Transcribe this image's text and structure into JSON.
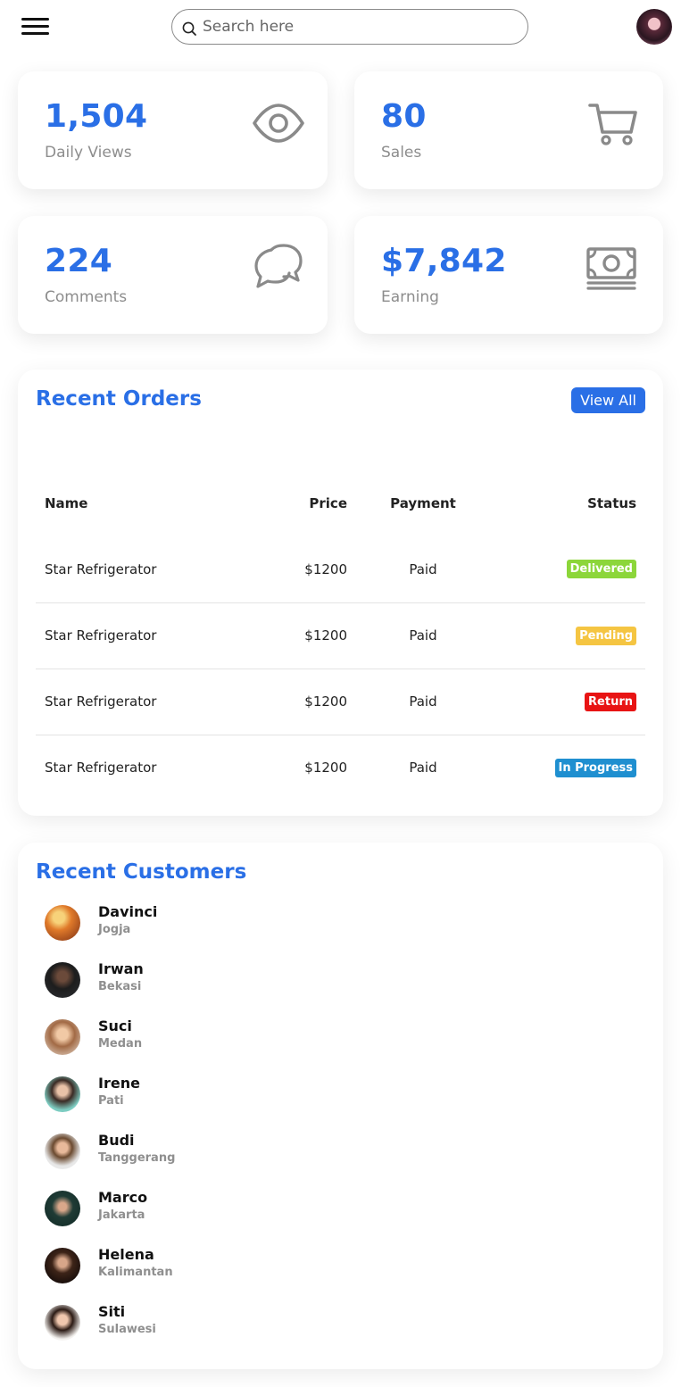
{
  "header": {
    "search_placeholder": "Search here",
    "icons": {
      "menu": "hamburger-menu-icon",
      "search": "search-icon"
    }
  },
  "stats": [
    {
      "value": "1,504",
      "label": "Daily Views",
      "icon": "eye-icon"
    },
    {
      "value": "80",
      "label": "Sales",
      "icon": "cart-icon"
    },
    {
      "value": "224",
      "label": "Comments",
      "icon": "chat-bubbles-icon"
    },
    {
      "value": "$7,842",
      "label": "Earning",
      "icon": "cash-icon"
    }
  ],
  "orders": {
    "title": "Recent Orders",
    "view_all_label": "View All",
    "columns": {
      "name": "Name",
      "price": "Price",
      "payment": "Payment",
      "status": "Status"
    },
    "rows": [
      {
        "name": "Star Refrigerator",
        "price": "$1200",
        "payment": "Paid",
        "status": "Delivered",
        "status_color": "#8cd63a"
      },
      {
        "name": "Star Refrigerator",
        "price": "$1200",
        "payment": "Paid",
        "status": "Pending",
        "status_color": "#f5c542"
      },
      {
        "name": "Star Refrigerator",
        "price": "$1200",
        "payment": "Paid",
        "status": "Return",
        "status_color": "#e81414"
      },
      {
        "name": "Star Refrigerator",
        "price": "$1200",
        "payment": "Paid",
        "status": "In Progress",
        "status_color": "#1f8fd0"
      }
    ]
  },
  "customers": {
    "title": "Recent Customers",
    "list": [
      {
        "name": "Davinci",
        "city": "Jogja"
      },
      {
        "name": "Irwan",
        "city": "Bekasi"
      },
      {
        "name": "Suci",
        "city": "Medan"
      },
      {
        "name": "Irene",
        "city": "Pati"
      },
      {
        "name": "Budi",
        "city": "Tanggerang"
      },
      {
        "name": "Marco",
        "city": "Jakarta"
      },
      {
        "name": "Helena",
        "city": "Kalimantan"
      },
      {
        "name": "Siti",
        "city": "Sulawesi"
      }
    ]
  },
  "colors": {
    "accent": "#2a6fe6",
    "muted": "#8d8d8d",
    "icon_gray": "#8a8a8a"
  }
}
